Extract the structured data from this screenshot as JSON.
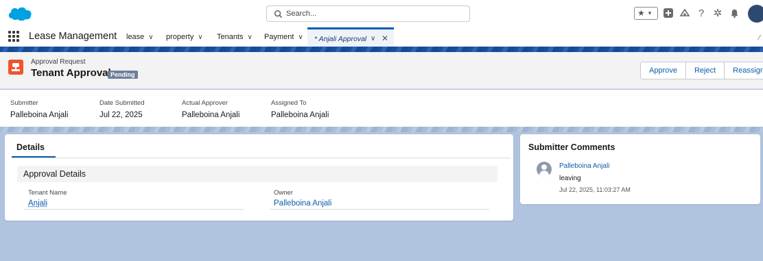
{
  "header": {
    "search_placeholder": "Search..."
  },
  "nav": {
    "app_name": "Lease Management",
    "items": [
      {
        "label": "lease"
      },
      {
        "label": "property"
      },
      {
        "label": "Tenants"
      },
      {
        "label": "Payment"
      }
    ],
    "active_tab": "* Anjali Approval"
  },
  "record": {
    "type": "Approval Request",
    "title": "Tenant Approval",
    "status_badge": "Pending",
    "buttons": {
      "approve": "Approve",
      "reject": "Reject",
      "reassign": "Reassign"
    }
  },
  "highlights": [
    {
      "label": "Submitter",
      "value": "Palleboina Anjali"
    },
    {
      "label": "Date Submitted",
      "value": "Jul 22, 2025"
    },
    {
      "label": "Actual Approver",
      "value": "Palleboina Anjali"
    },
    {
      "label": "Assigned To",
      "value": "Palleboina Anjali"
    }
  ],
  "details": {
    "tab_label": "Details",
    "section_title": "Approval Details",
    "fields": [
      {
        "label": "Tenant Name",
        "value": "Anjali"
      },
      {
        "label": "Owner",
        "value": "Palleboina Anjali"
      }
    ]
  },
  "comments": {
    "title": "Submitter Comments",
    "author": "Palleboina Anjali",
    "text": "leaving",
    "timestamp": "Jul 22, 2025, 11:03:27 AM"
  },
  "colors": {
    "brand_blue": "#0b5cab",
    "record_icon": "#f0542d",
    "background": "#b0c4df"
  }
}
